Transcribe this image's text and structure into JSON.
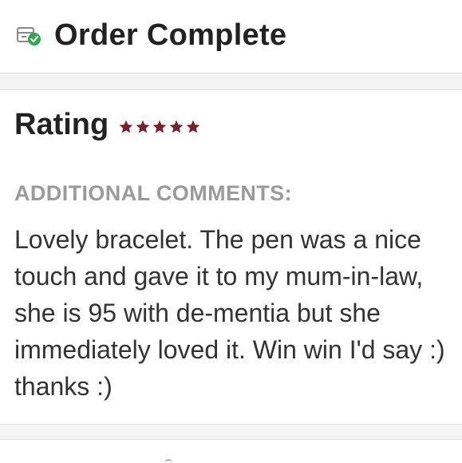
{
  "header": {
    "title": "Order Complete",
    "icon": "package-check-icon"
  },
  "review": {
    "rating_label": "Rating",
    "rating_value": 5,
    "rating_max": 5,
    "star_color": "#7a1f2e",
    "comments_heading": "ADDITIONAL COMMENTS:",
    "comments_text": "Lovely bracelet. The pen was a nice touch and gave it to my mum-in-law, she is 95 with de-mentia but she immediately loved it. Win win I'd say :) thanks :)"
  },
  "colors": {
    "check_green": "#2fa84f",
    "background": "#f4f4f4",
    "card": "#ffffff"
  }
}
